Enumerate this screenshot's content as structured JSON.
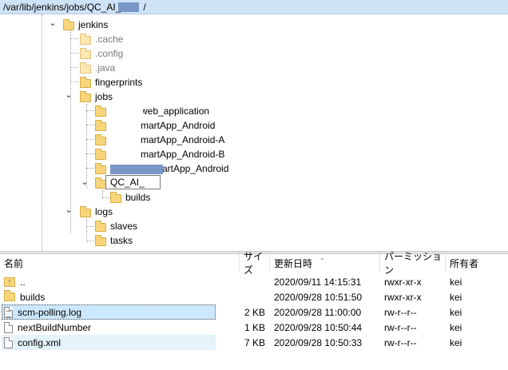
{
  "path_bar": {
    "path": "/var/lib/jenkins/jobs/QC_AI_",
    "suffix": "/"
  },
  "tree": {
    "items": [
      {
        "label": "jenkins",
        "toggle": "⌄"
      },
      {
        "label": ".cache"
      },
      {
        "label": ".config"
      },
      {
        "label": ".java"
      },
      {
        "label": "fingerprints"
      },
      {
        "label": "jobs",
        "toggle": "⌄"
      },
      {
        "label": "web_application"
      },
      {
        "label": "martApp_Android"
      },
      {
        "label": "martApp_Android-A"
      },
      {
        "label": "martApp_Android-B"
      },
      {
        "label": "artApp_Android"
      },
      {
        "label": "QC_AI_",
        "toggle": "⌄"
      },
      {
        "label": "builds"
      },
      {
        "label": "logs",
        "toggle": "⌄"
      },
      {
        "label": "slaves"
      },
      {
        "label": "tasks"
      }
    ]
  },
  "list": {
    "columns": {
      "name": "名前",
      "size": "サイズ",
      "modified": "更新日時",
      "permission": "パーミッション",
      "owner": "所有者"
    },
    "rows": [
      {
        "name": "..",
        "size": "",
        "modified": "2020/09/11 14:15:31",
        "permission": "rwxr-xr-x",
        "owner": "kei",
        "icon": "up-folder-icon"
      },
      {
        "name": "builds",
        "size": "",
        "modified": "2020/09/28 10:51:50",
        "permission": "rwxr-xr-x",
        "owner": "kei",
        "icon": "folder-icon"
      },
      {
        "name": "scm-polling.log",
        "size": "2 KB",
        "modified": "2020/09/28 11:00:00",
        "permission": "rw-r--r--",
        "owner": "kei",
        "icon": "log-file-icon"
      },
      {
        "name": "nextBuildNumber",
        "size": "1 KB",
        "modified": "2020/09/28 10:50:44",
        "permission": "rw-r--r--",
        "owner": "kei",
        "icon": "file-icon"
      },
      {
        "name": "config.xml",
        "size": "7 KB",
        "modified": "2020/09/28 10:50:33",
        "permission": "rw-r--r--",
        "owner": "kei",
        "icon": "file-icon"
      }
    ]
  },
  "colors": {
    "path_bar_bg": "#cfe3f7",
    "redaction": "#7a96c6",
    "folder": "#f8d57a",
    "row_highlight": "#e5f3fb"
  }
}
